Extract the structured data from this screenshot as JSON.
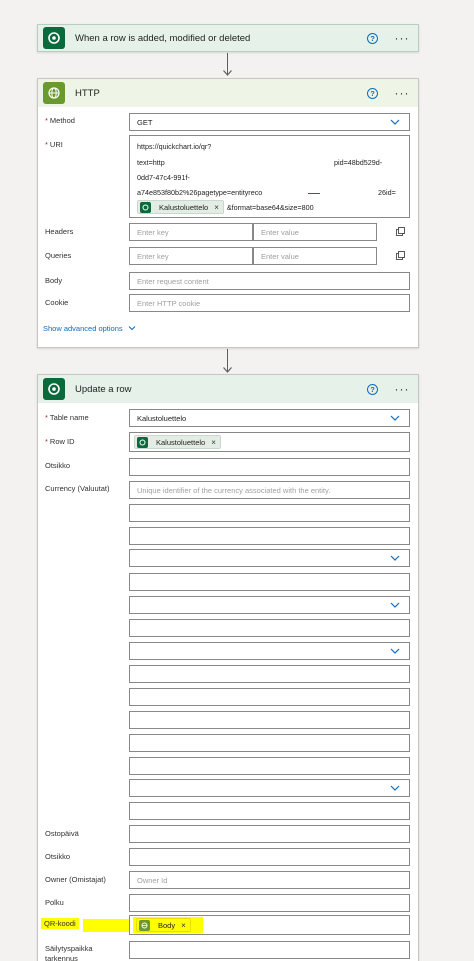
{
  "trigger": {
    "title": "When a row is added, modified or deleted"
  },
  "http": {
    "title": "HTTP",
    "method_label": "Method",
    "method_value": "GET",
    "uri_label": "URI",
    "uri_lines": [
      "https://quickchart.io/qr?",
      "text=http",
      "pid=48bd529d-",
      "0dd7-47c4-991f-",
      "a74e853f80b2%26pagetype=entityreco",
      "26id="
    ],
    "uri_token": "Kalustoluettelo",
    "uri_suffix": "&format=base64&size=800",
    "headers_label": "Headers",
    "queries_label": "Queries",
    "key_placeholder": "Enter key",
    "value_placeholder": "Enter value",
    "body_label": "Body",
    "body_placeholder": "Enter request content",
    "cookie_label": "Cookie",
    "cookie_placeholder": "Enter HTTP cookie",
    "advanced_label": "Show advanced options"
  },
  "update": {
    "title": "Update a row",
    "table_label": "Table name",
    "table_value": "Kalustoluettelo",
    "rowid_label": "Row ID",
    "rowid_token": "Kalustoluettelo",
    "otsikko_label": "Otsikko",
    "currency_label": "Currency (Valuutat)",
    "currency_placeholder": "Unique identifier of the currency associated with the entity.",
    "ostopaiva_label": "Ostopäivä",
    "otsikko2_label": "Otsikko",
    "owner_label": "Owner (Omistajat)",
    "owner_placeholder": "Owner Id",
    "polku_label": "Polku",
    "qr_label": "QR-koodi",
    "qr_token": "Body",
    "sailytys_label_1": "Säilytyspaikka",
    "sailytys_label_2": "tarkennus"
  },
  "colors": {
    "dataverse_green": "#0b6a3c",
    "http_green": "#6a9a2f",
    "link_blue": "#0f6cbd",
    "required_red": "#a4262c",
    "highlight_yellow": "#ffff00"
  },
  "icons": {
    "dataverse": "dataverse-icon",
    "http": "globe-icon",
    "help": "help-icon",
    "more": "more-icon",
    "chevron": "chevron-down-icon",
    "clear": "close-icon",
    "switch": "switch-to-text-icon"
  }
}
